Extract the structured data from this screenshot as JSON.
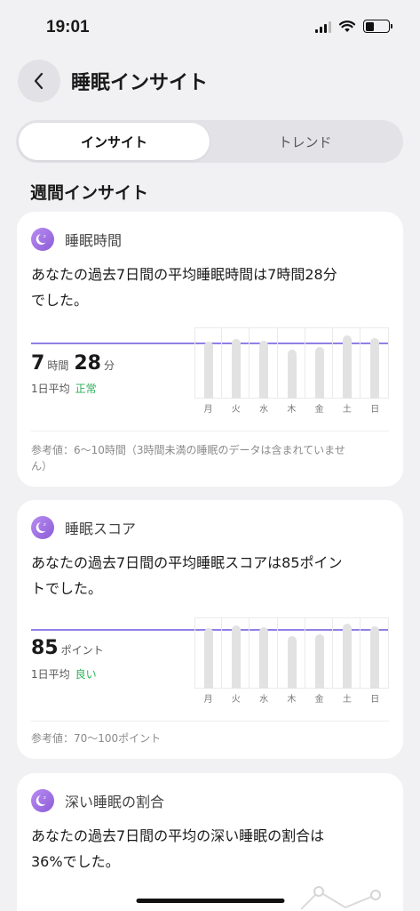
{
  "status": {
    "time": "19:01"
  },
  "nav": {
    "title": "睡眠インサイト"
  },
  "tabs": [
    {
      "label": "インサイト",
      "active": true
    },
    {
      "label": "トレンド",
      "active": false
    }
  ],
  "section_title": "週間インサイト",
  "weekdays": [
    "月",
    "火",
    "水",
    "木",
    "金",
    "土",
    "日"
  ],
  "cards": [
    {
      "label": "睡眠時間",
      "desc_line1": "あなたの過去7日間の平均睡眠時間は7時間28分",
      "desc_line2": "でした。",
      "value1": "7",
      "unit1": "時間",
      "value2": "28",
      "unit2": "分",
      "sub_label": "1日平均",
      "status": "正常",
      "ref_line1": "参考値：6〜10時間（3時間未満の睡眠のデータは含まれていませ",
      "ref_line2": "ん）",
      "bar_levels": [
        0.84,
        0.88,
        0.86,
        0.72,
        0.76,
        0.94,
        0.9
      ]
    },
    {
      "label": "睡眠スコア",
      "desc_line1": "あなたの過去7日間の平均睡眠スコアは85ポイン",
      "desc_line2": "トでした。",
      "value1": "85",
      "unit1": "ポイント",
      "sub_label": "1日平均",
      "status": "良い",
      "ref_line1": "参考値：70〜100ポイント",
      "bar_levels": [
        0.9,
        0.93,
        0.91,
        0.78,
        0.8,
        0.96,
        0.92
      ]
    },
    {
      "label": "深い睡眠の割合",
      "desc_line1": "あなたの過去7日間の平均の深い睡眠の割合は",
      "desc_line2": "36%でした。"
    }
  ]
}
